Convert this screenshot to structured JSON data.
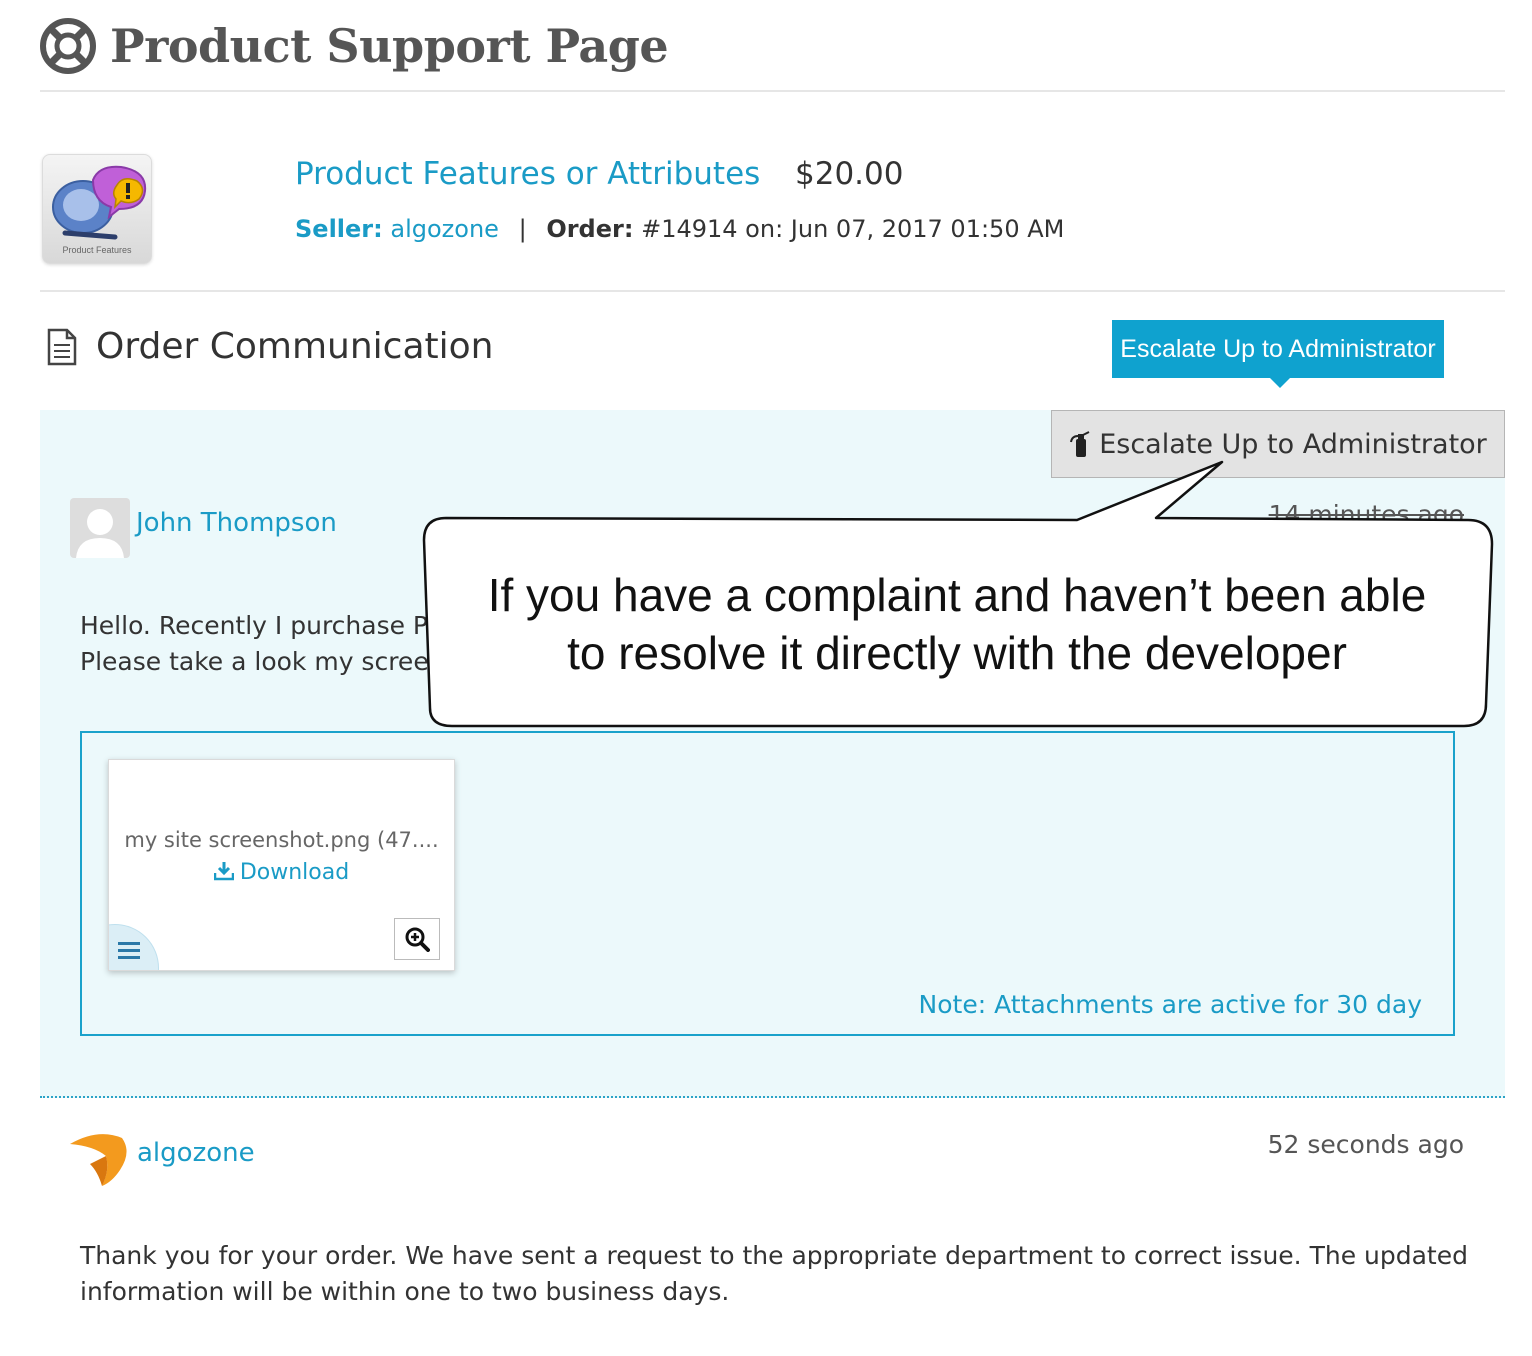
{
  "page": {
    "title": "Product Support Page"
  },
  "product": {
    "thumb_caption": "Product Features",
    "name": "Product Features or Attributes",
    "price": "$20.00",
    "seller_label": "Seller:",
    "seller_name": "algozone",
    "separator": "|",
    "order_label": "Order:",
    "order_value": "#14914 on: Jun 07, 2017 01:50 AM"
  },
  "communication": {
    "title": "Order Communication",
    "tooltip": "Escalate Up to Administrator",
    "escalate_button": "Escalate Up to Administrator"
  },
  "callout": {
    "line1": "If you have a complaint and haven’t been able",
    "line2": "to resolve it directly with the developer"
  },
  "messages": [
    {
      "author": "John Thompson",
      "time": "14 minutes ago",
      "line1": "Hello. Recently I purchase Product Features or Attributes extension but have a small problem.",
      "line2": "Please take a look my screenshot"
    },
    {
      "author": "algozone",
      "time": "52 seconds ago",
      "text": "Thank you for your order. We have sent a request to the appropriate department to correct issue. The updated information will be within one to two business days."
    }
  ],
  "attachment": {
    "file_name": "my site screenshot.png (47....",
    "download_label": "Download",
    "note": "Note: Attachments are active for 30 day"
  },
  "colors": {
    "accent": "#1a9bc6",
    "button_blue": "#0fa2cf",
    "panel_bg": "#ecf9fb",
    "logo_orange": "#f39a1e"
  }
}
